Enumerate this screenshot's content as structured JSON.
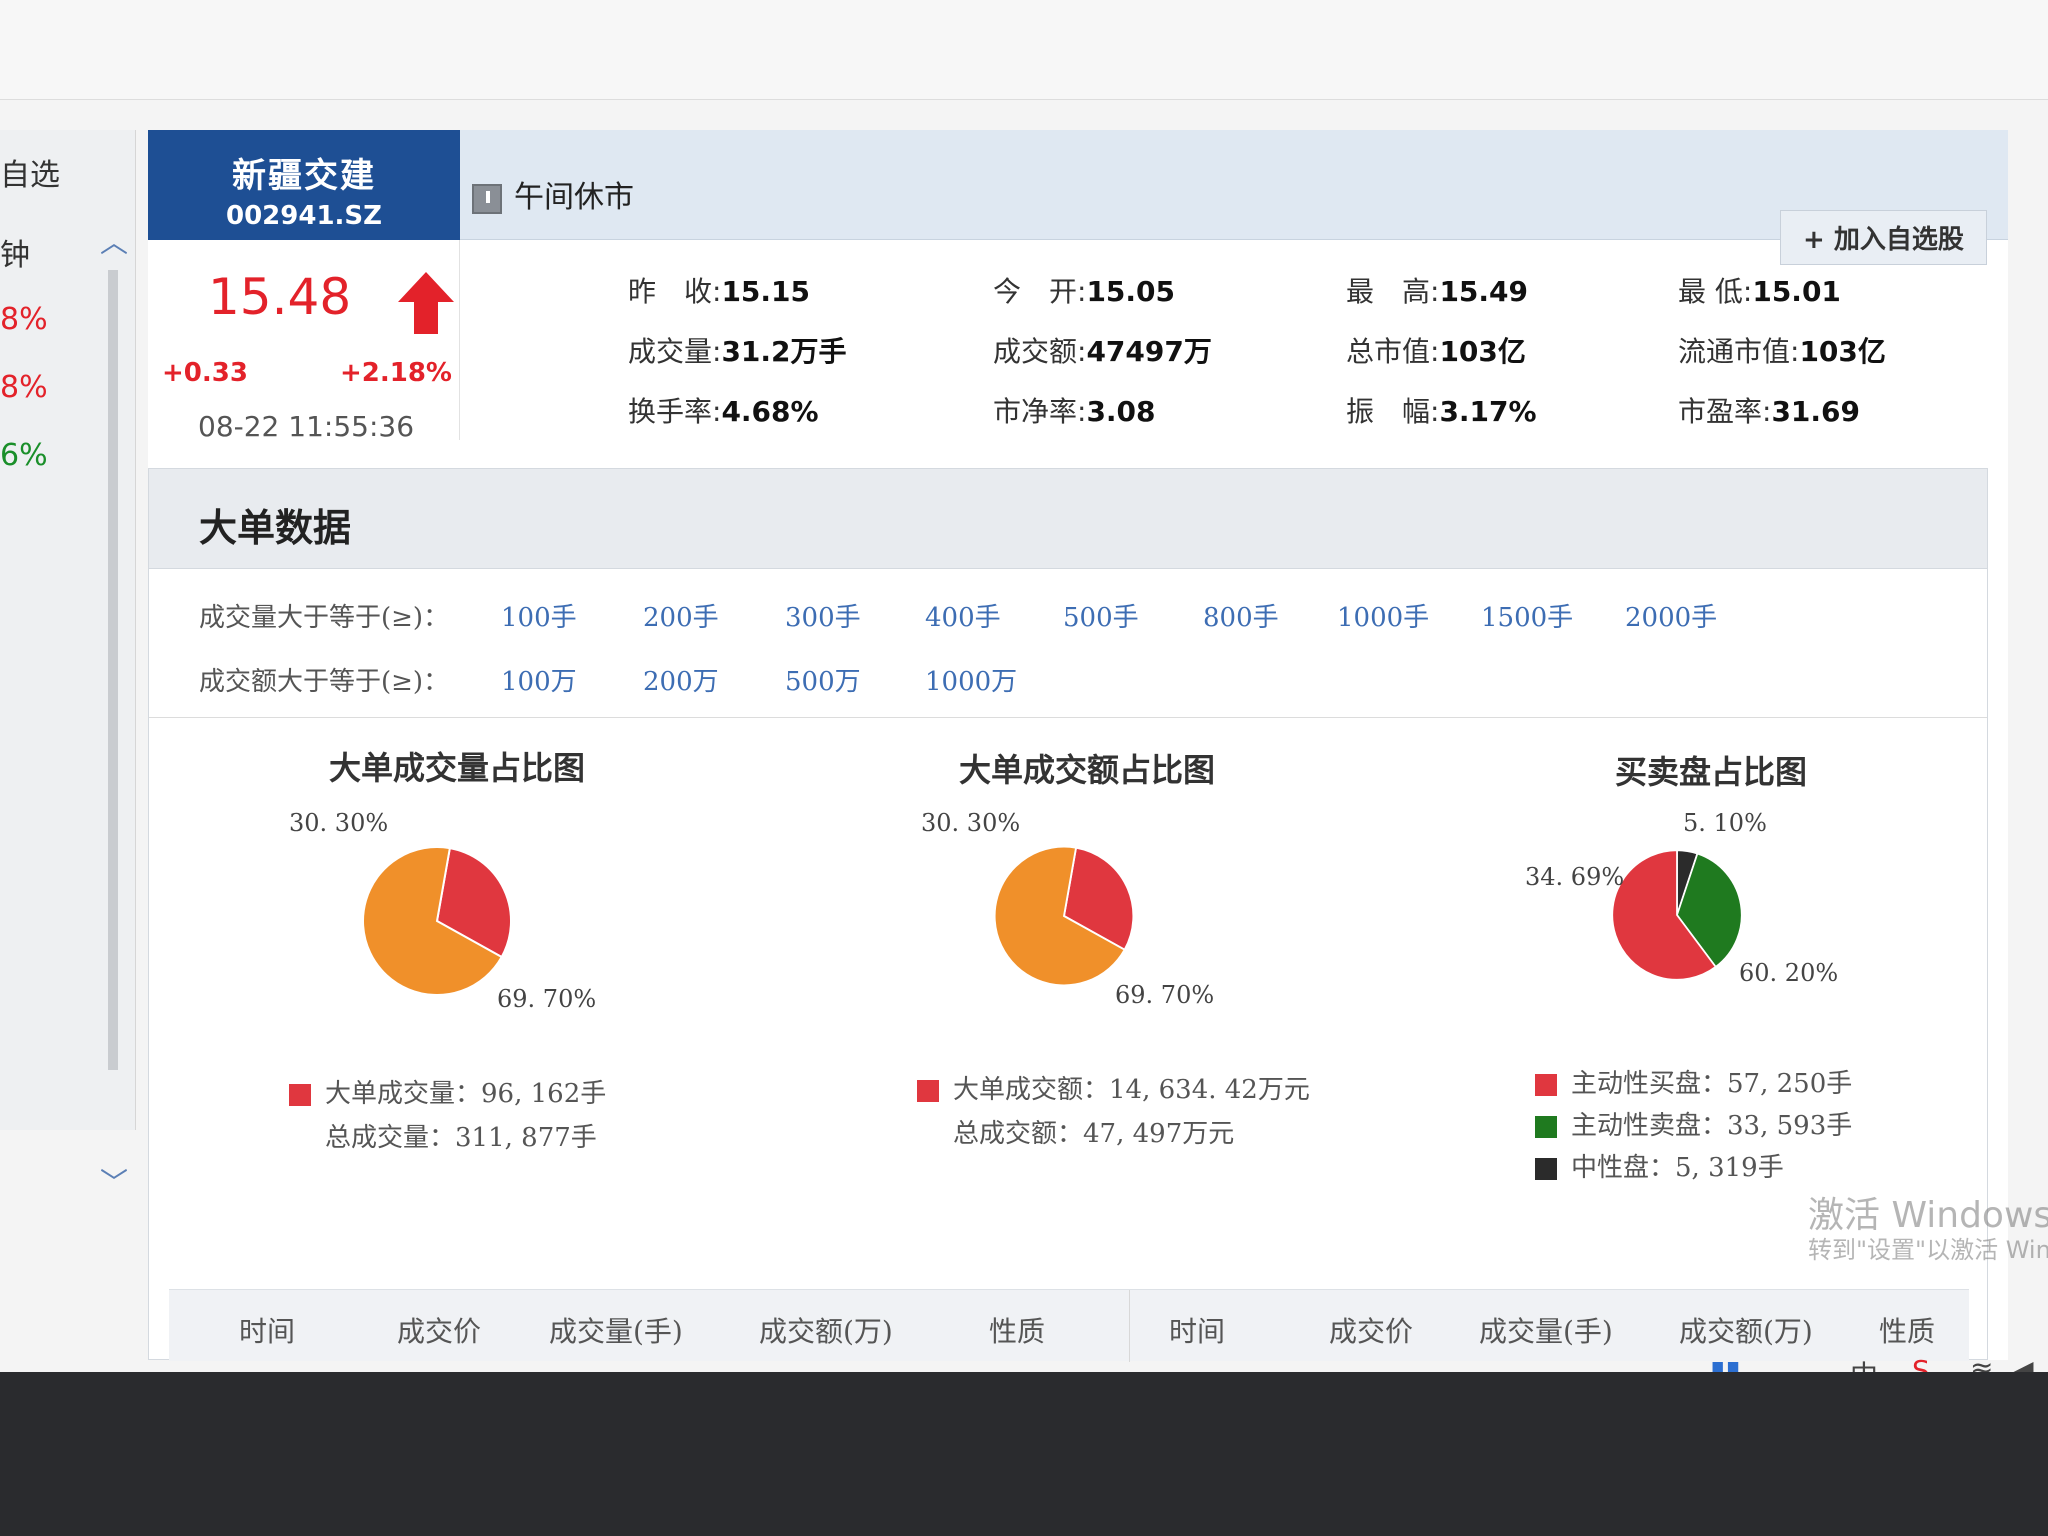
{
  "sidebar": {
    "items": [
      "自选",
      "钟",
      "8%",
      "8%",
      "6%"
    ]
  },
  "header": {
    "stock_name": "新疆交建",
    "stock_code": "002941.SZ",
    "status": "午间休市",
    "add_button": "+ 加入自选股"
  },
  "quote": {
    "price": "15.48",
    "change": "+0.33",
    "change_pct": "+2.18%",
    "time": "08-22 11:55:36",
    "stats": [
      {
        "label": "昨　收:",
        "value": "15.15"
      },
      {
        "label": "今　开:",
        "value": "15.05"
      },
      {
        "label": "最　高:",
        "value": "15.49"
      },
      {
        "label": "最 低:",
        "value": "15.01"
      },
      {
        "label": "成交量:",
        "value": "31.2万手"
      },
      {
        "label": "成交额:",
        "value": "47497万"
      },
      {
        "label": "总市值:",
        "value": "103亿"
      },
      {
        "label": "流通市值:",
        "value": "103亿"
      },
      {
        "label": "换手率:",
        "value": "4.68%"
      },
      {
        "label": "市净率:",
        "value": "3.08"
      },
      {
        "label": "振　幅:",
        "value": "3.17%"
      },
      {
        "label": "市盈率:",
        "value": "31.69"
      }
    ]
  },
  "big_orders": {
    "title": "大单数据",
    "volume_filter_label": "成交量大于等于(≥)：",
    "volume_filters": [
      "100手",
      "200手",
      "300手",
      "400手",
      "500手",
      "800手",
      "1000手",
      "1500手",
      "2000手"
    ],
    "amount_filter_label": "成交额大于等于(≥)：",
    "amount_filters": [
      "100万",
      "200万",
      "500万",
      "1000万"
    ]
  },
  "charts": {
    "volume": {
      "title": "大单成交量占比图",
      "label_a": "30. 30%",
      "label_b": "69. 70%",
      "legend_1": "大单成交量：96, 162手",
      "legend_2": "总成交量：311, 877手"
    },
    "amount": {
      "title": "大单成交额占比图",
      "label_a": "30. 30%",
      "label_b": "69. 70%",
      "legend_1": "大单成交额：14, 634. 42万元",
      "legend_2": "总成交额：47, 497万元"
    },
    "buysell": {
      "title": "买卖盘占比图",
      "label_a": "5. 10%",
      "label_b": "34. 69%",
      "label_c": "60. 20%",
      "legend_1": "主动性买盘：57, 250手",
      "legend_2": "主动性卖盘：33, 593手",
      "legend_3": "中性盘：5, 319手"
    }
  },
  "chart_data": [
    {
      "type": "pie",
      "title": "大单成交量占比图",
      "values": [
        30.3,
        69.7
      ],
      "colors": [
        "#e0373f",
        "#f0902a"
      ]
    },
    {
      "type": "pie",
      "title": "大单成交额占比图",
      "values": [
        30.3,
        69.7
      ],
      "colors": [
        "#e0373f",
        "#f0902a"
      ]
    },
    {
      "type": "pie",
      "title": "买卖盘占比图",
      "values": [
        5.1,
        34.69,
        60.2
      ],
      "colors": [
        "#2b2b2b",
        "#1f7a1f",
        "#e0373f"
      ]
    }
  ],
  "table": {
    "headers": [
      "时间",
      "成交价",
      "成交量(手)",
      "成交额(万)",
      "性质",
      "时间",
      "成交价",
      "成交量(手)",
      "成交额(万)",
      "性质"
    ]
  },
  "watermark": {
    "line1": "激活 Windows",
    "line2": "转到\"设置\"以激活 Windows。"
  },
  "colors": {
    "brand_blue": "#1e4f94",
    "up_red": "#e3222a",
    "link_blue": "#3d6db3"
  }
}
